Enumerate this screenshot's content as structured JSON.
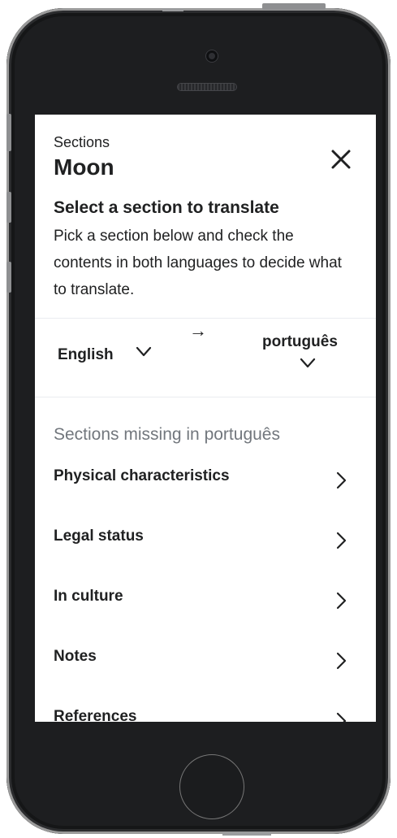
{
  "header": {
    "eyebrow": "Sections",
    "article_title": "Moon",
    "close_icon": "close-icon",
    "heading": "Select a section to translate",
    "description": "Pick a section below and check the contents in both languages to decide what to translate."
  },
  "languages": {
    "source": "English",
    "target": "português",
    "arrow": "→"
  },
  "missing_sections": {
    "heading": "Sections missing in português",
    "items": [
      {
        "label": "Physical characteristics"
      },
      {
        "label": "Legal status"
      },
      {
        "label": "In culture"
      },
      {
        "label": "Notes"
      },
      {
        "label": "References"
      }
    ]
  },
  "colors": {
    "text": "#202122",
    "muted": "#72777d",
    "divider": "#eaecf0",
    "device": "#1d1e20"
  }
}
